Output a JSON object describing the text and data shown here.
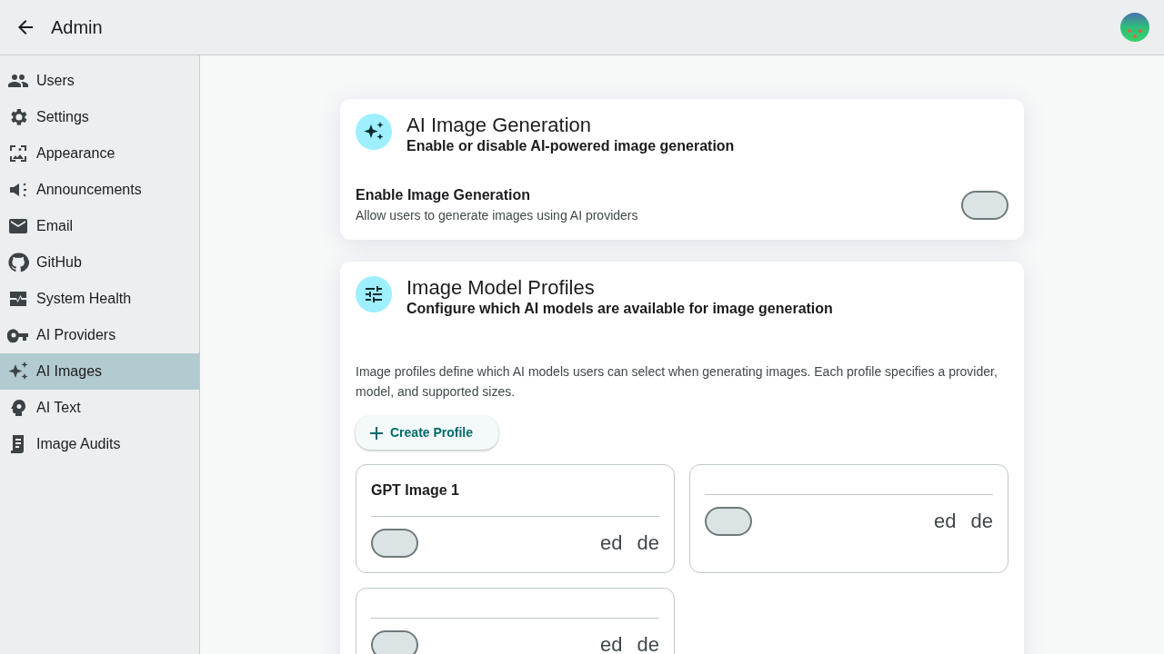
{
  "app_bar": {
    "title": "Admin"
  },
  "sidebar": {
    "items": [
      {
        "label": "Users",
        "selected": false
      },
      {
        "label": "Settings",
        "selected": false
      },
      {
        "label": "Appearance",
        "selected": false
      },
      {
        "label": "Announcements",
        "selected": false
      },
      {
        "label": "Email",
        "selected": false
      },
      {
        "label": "GitHub",
        "selected": false
      },
      {
        "label": "System Health",
        "selected": false
      },
      {
        "label": "AI Providers",
        "selected": false
      },
      {
        "label": "AI Images",
        "selected": true
      },
      {
        "label": "AI Text",
        "selected": false
      },
      {
        "label": "Image Audits",
        "selected": false
      }
    ]
  },
  "generation_card": {
    "title": "AI Image Generation",
    "subtitle": "Enable or disable AI-powered image generation",
    "setting": {
      "label": "Enable Image Generation",
      "description": "Allow users to generate images using AI providers",
      "on": false
    }
  },
  "profiles_card": {
    "title": "Image Model Profiles",
    "subtitle": "Configure which AI models are available for image generation",
    "description": "Image profiles define which AI models users can select when generating images. Each profile specifies a provider, model, and supported sizes.",
    "create_button": "Create Profile",
    "profiles": [
      {
        "name": "GPT Image 1",
        "on": false,
        "edit": "ed",
        "delete": "de"
      },
      {
        "on": false,
        "edit": "ed",
        "delete": "de"
      },
      {
        "on": false,
        "edit": "ed",
        "delete": "de"
      }
    ]
  }
}
